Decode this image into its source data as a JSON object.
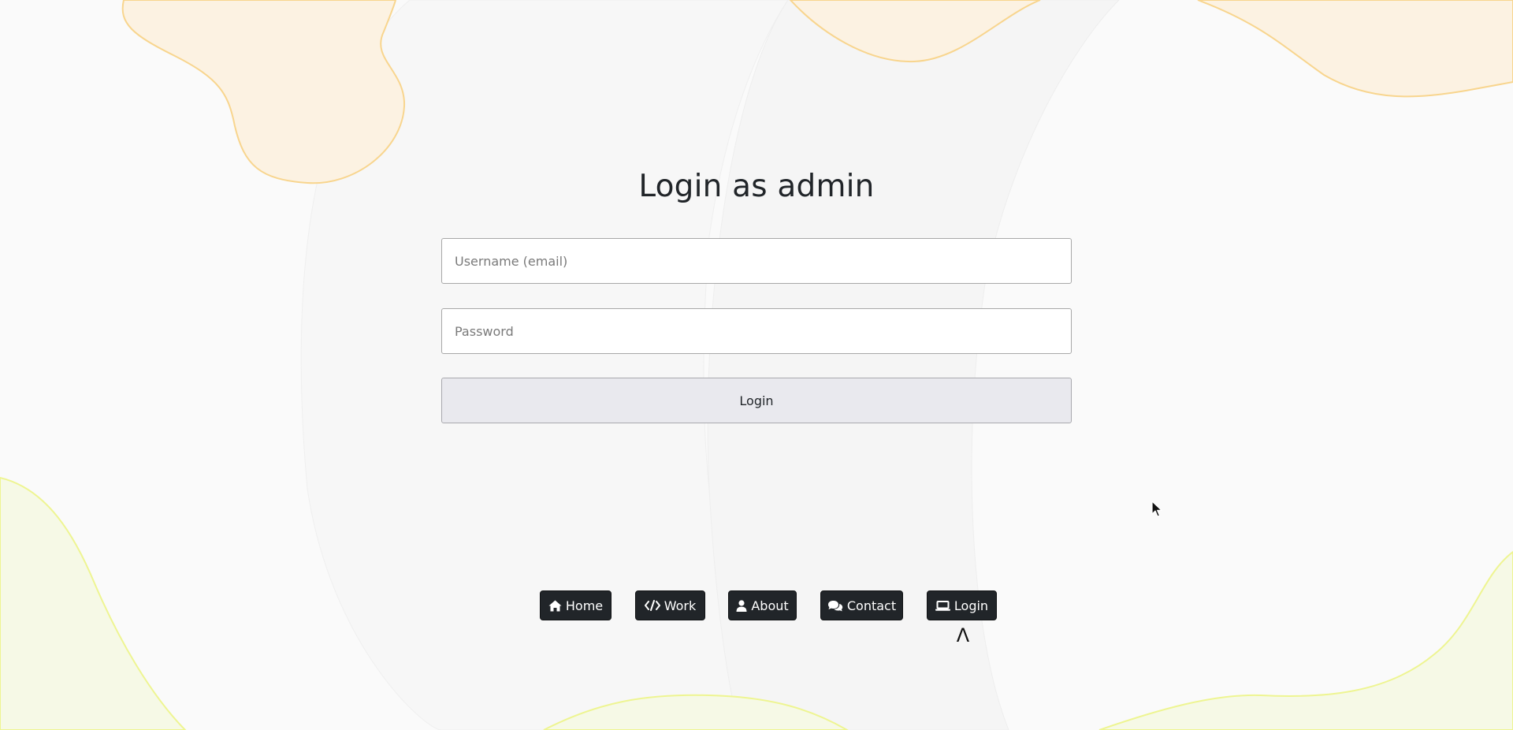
{
  "page": {
    "title": "Login as admin"
  },
  "form": {
    "username_placeholder": "Username (email)",
    "username_value": "",
    "password_placeholder": "Password",
    "password_value": "",
    "submit_label": "Login"
  },
  "nav": {
    "items": [
      {
        "label": "Home",
        "icon": "home-icon"
      },
      {
        "label": "Work",
        "icon": "code-icon"
      },
      {
        "label": "About",
        "icon": "user-icon"
      },
      {
        "label": "Contact",
        "icon": "chat-icon"
      },
      {
        "label": "Login",
        "icon": "laptop-icon"
      }
    ],
    "active_index": 4,
    "active_marker": "Λ"
  },
  "colors": {
    "background": "#fafafa",
    "blob_orange_fill": "#fcf2e2",
    "blob_orange_stroke": "#f8d58e",
    "blob_green_fill": "#f6f9e6",
    "blob_green_stroke": "#eef592",
    "nav_button": "#212529",
    "submit_button": "#e9e9ee"
  }
}
